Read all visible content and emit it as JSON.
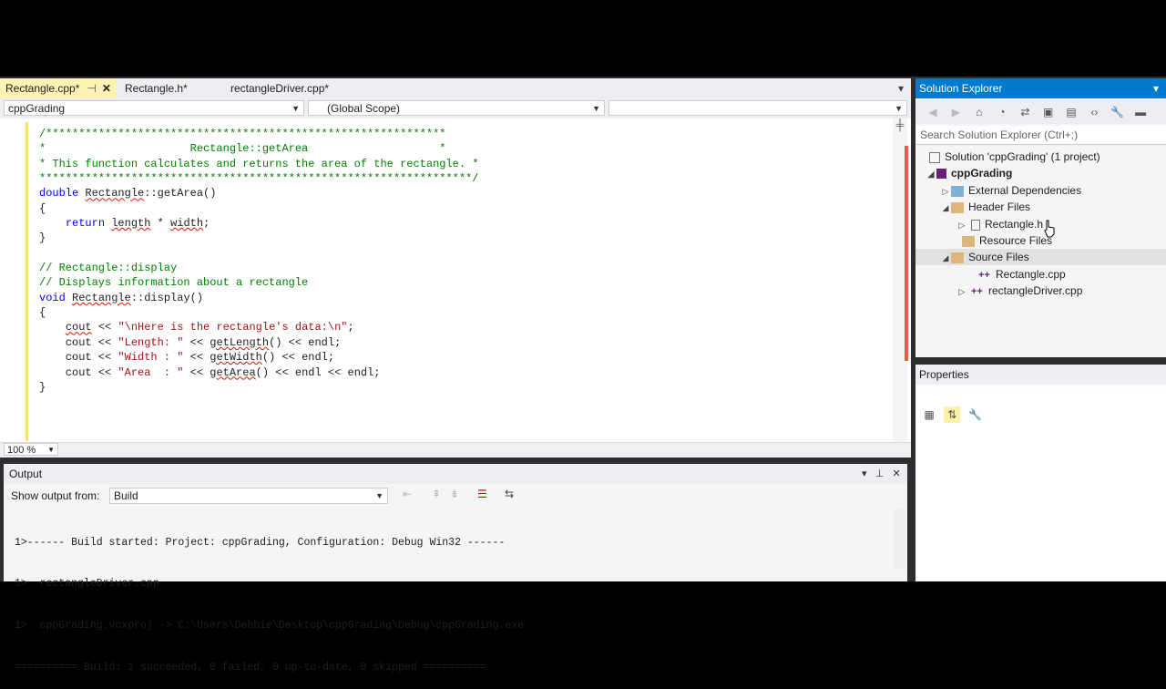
{
  "tabs": [
    {
      "label": "Rectangle.cpp*",
      "active": true
    },
    {
      "label": "Rectangle.h*",
      "active": false
    },
    {
      "label": "rectangleDriver.cpp*",
      "active": false
    }
  ],
  "nav": {
    "project": "cppGrading",
    "scope": "(Global Scope)",
    "member": ""
  },
  "code_lines": [
    [
      {
        "c": "cm",
        "t": "/*************************************************************"
      }
    ],
    [
      {
        "c": "cm",
        "t": "*                      Rectangle::getArea                    *"
      }
    ],
    [
      {
        "c": "cm",
        "t": "* This function calculates and returns the area of the rectangle. *"
      }
    ],
    [
      {
        "c": "cm",
        "t": "******************************************************************/"
      }
    ],
    [
      {
        "c": "kw",
        "t": "double"
      },
      {
        "c": "",
        "t": " "
      },
      {
        "c": "sq",
        "t": "Rectangle"
      },
      {
        "c": "",
        "t": "::getArea()"
      }
    ],
    [
      {
        "c": "",
        "t": "{"
      }
    ],
    [
      {
        "c": "",
        "t": "    "
      },
      {
        "c": "kw",
        "t": "return"
      },
      {
        "c": "",
        "t": " "
      },
      {
        "c": "sq",
        "t": "length"
      },
      {
        "c": "",
        "t": " * "
      },
      {
        "c": "sq",
        "t": "width"
      },
      {
        "c": "",
        "t": ";"
      }
    ],
    [
      {
        "c": "",
        "t": "}"
      }
    ],
    [
      {
        "c": "",
        "t": ""
      }
    ],
    [
      {
        "c": "cm",
        "t": "// Rectangle::display"
      }
    ],
    [
      {
        "c": "cm",
        "t": "// Displays information about a rectangle"
      }
    ],
    [
      {
        "c": "kw",
        "t": "void"
      },
      {
        "c": "",
        "t": " "
      },
      {
        "c": "sq",
        "t": "Rectangle"
      },
      {
        "c": "",
        "t": "::display()"
      }
    ],
    [
      {
        "c": "",
        "t": "{"
      }
    ],
    [
      {
        "c": "",
        "t": "    "
      },
      {
        "c": "sq",
        "t": "cout"
      },
      {
        "c": "",
        "t": " << "
      },
      {
        "c": "st",
        "t": "\"\\nHere is the rectangle's data:\\n\""
      },
      {
        "c": "",
        "t": ";"
      }
    ],
    [
      {
        "c": "",
        "t": "    cout << "
      },
      {
        "c": "st",
        "t": "\"Length: \""
      },
      {
        "c": "",
        "t": " << "
      },
      {
        "c": "sq",
        "t": "getLength"
      },
      {
        "c": "",
        "t": "() << endl;"
      }
    ],
    [
      {
        "c": "",
        "t": "    cout << "
      },
      {
        "c": "st",
        "t": "\"Width : \""
      },
      {
        "c": "",
        "t": " << "
      },
      {
        "c": "sq",
        "t": "getWidth"
      },
      {
        "c": "",
        "t": "() << endl;"
      }
    ],
    [
      {
        "c": "",
        "t": "    cout << "
      },
      {
        "c": "st",
        "t": "\"Area  : \""
      },
      {
        "c": "",
        "t": " << "
      },
      {
        "c": "sq",
        "t": "getArea"
      },
      {
        "c": "",
        "t": "() << endl << endl;"
      }
    ],
    [
      {
        "c": "",
        "t": "}"
      }
    ]
  ],
  "zoom": "100 %",
  "output": {
    "title": "Output",
    "show_from_label": "Show output from:",
    "source": "Build",
    "lines": [
      "1>------ Build started: Project: cppGrading, Configuration: Debug Win32 ------",
      "1>  rectangleDriver.cpp",
      "1>  cppGrading.vcxproj -> C:\\Users\\Debbie\\Desktop\\cppGrading\\Debug\\cppGrading.exe",
      "========== Build: 1 succeeded, 0 failed, 0 up-to-date, 0 skipped =========="
    ]
  },
  "solution_explorer": {
    "title": "Solution Explorer",
    "search_placeholder": "Search Solution Explorer (Ctrl+;)",
    "solution": "Solution 'cppGrading' (1 project)",
    "project": "cppGrading",
    "external": "External Dependencies",
    "header_files": "Header Files",
    "header_item": "Rectangle.h",
    "resource_files": "Resource Files",
    "source_files": "Source Files",
    "source_item1": "Rectangle.cpp",
    "source_item2": "rectangleDriver.cpp"
  },
  "properties": {
    "title": "Properties"
  },
  "colors": {
    "accent": "#007acc",
    "active_tab": "#fff2b3",
    "error": "#e51400",
    "comment": "#008000",
    "keyword": "#0000ff",
    "string": "#a31515"
  }
}
